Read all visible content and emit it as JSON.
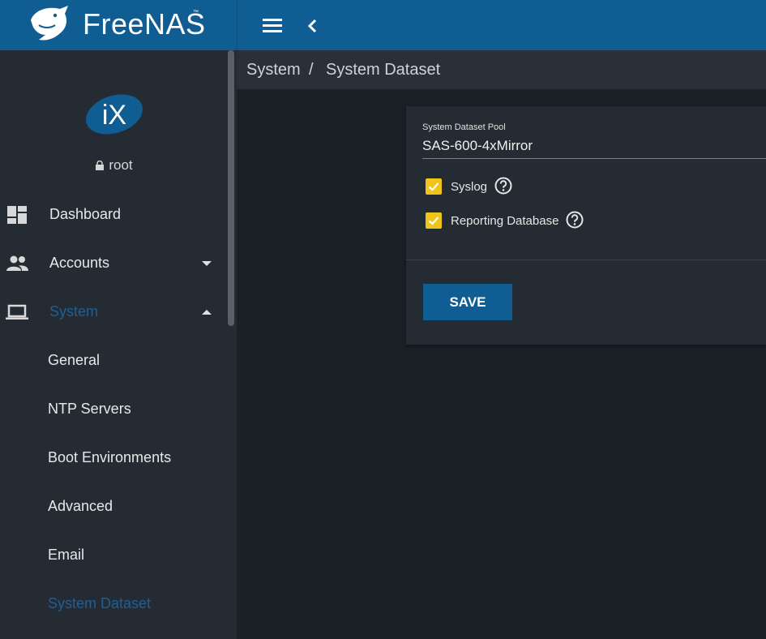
{
  "topbar": {
    "brand_name": "FreeNAS",
    "brand_tm": "™",
    "menu_icon": "hamburger-menu-icon",
    "back_icon": "chevron-left-icon",
    "color": "#0f5d93"
  },
  "sidebar": {
    "logo": "iX",
    "username": "root",
    "items": [
      {
        "label": "Dashboard",
        "icon": "dashboard-icon"
      },
      {
        "label": "Accounts",
        "icon": "people-icon"
      },
      {
        "label": "System",
        "icon": "laptop-icon"
      }
    ],
    "system_children": [
      {
        "label": "General"
      },
      {
        "label": "NTP Servers"
      },
      {
        "label": "Boot Environments"
      },
      {
        "label": "Advanced"
      },
      {
        "label": "Email"
      },
      {
        "label": "System Dataset"
      }
    ],
    "active_color": "#1f5f96"
  },
  "breadcrumb": {
    "parent": "System",
    "separator": "/",
    "current": "System Dataset"
  },
  "form": {
    "pool_label": "System Dataset Pool",
    "pool_value": "SAS-600-4xMirror",
    "syslog_label": "Syslog",
    "syslog_checked": true,
    "reporting_label": "Reporting Database",
    "reporting_checked": true,
    "save_label": "SAVE",
    "checkbox_color": "#f0c419"
  }
}
